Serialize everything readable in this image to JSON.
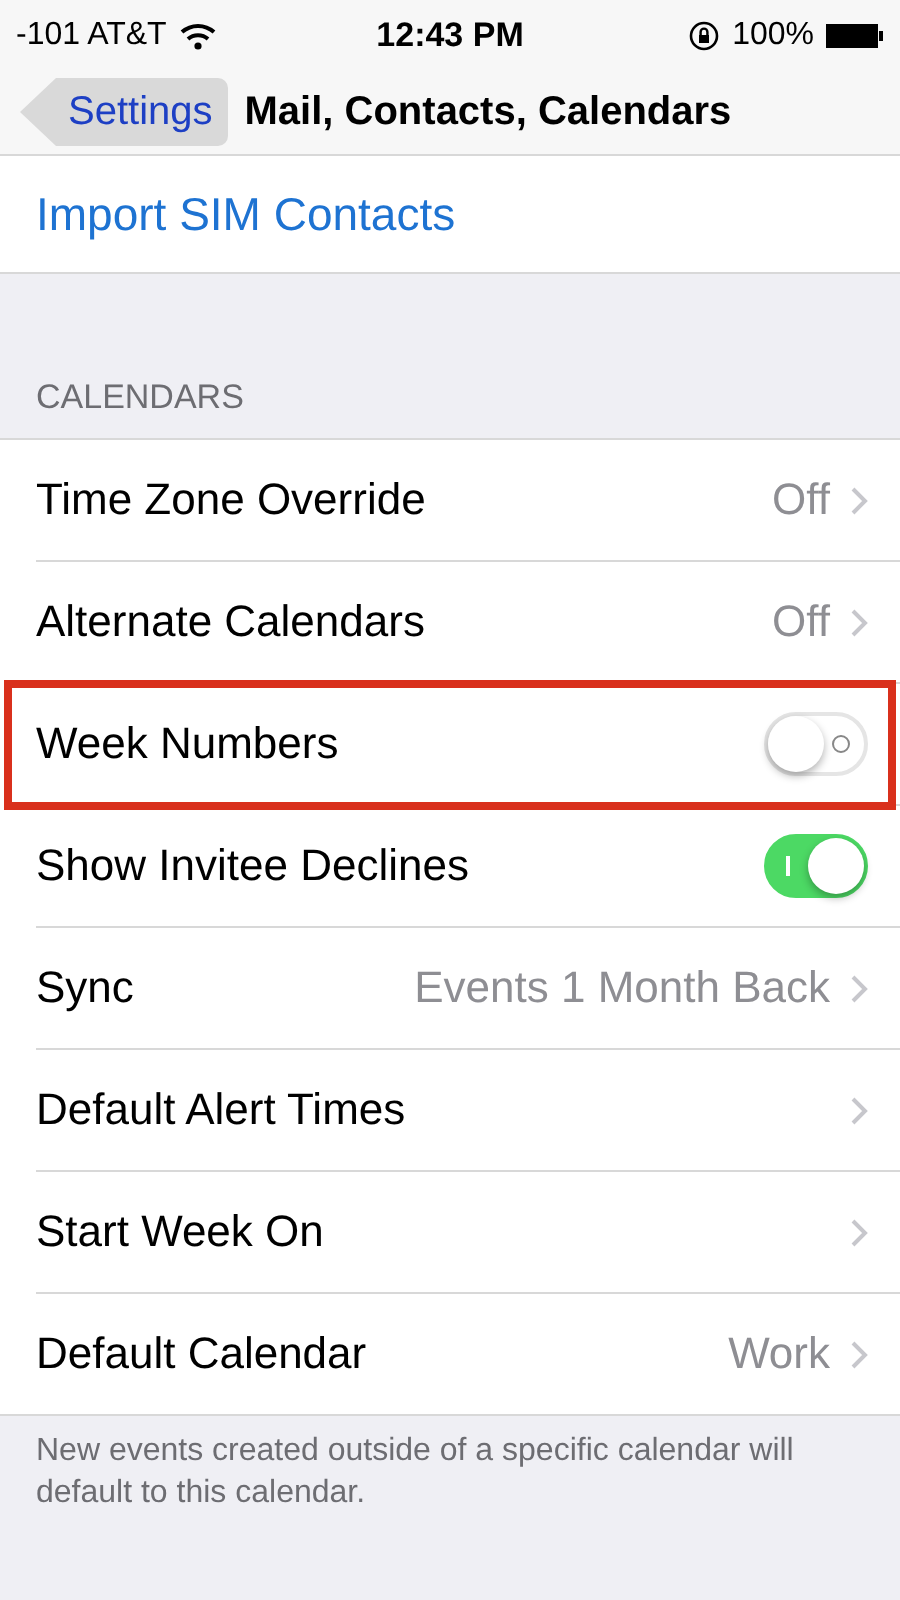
{
  "status_bar": {
    "carrier": "-101 AT&T",
    "time": "12:43 PM",
    "battery": "100%"
  },
  "nav_bar": {
    "back": "Settings",
    "title": "Mail, Contacts, Calendars"
  },
  "action": {
    "label": "Import SIM Contacts"
  },
  "section": {
    "header": "CALENDARS",
    "rows": [
      {
        "kind": "value",
        "label": "Time Zone Override",
        "value": "Off",
        "highlighted": false
      },
      {
        "kind": "value",
        "label": "Alternate Calendars",
        "value": "Off",
        "highlighted": false
      },
      {
        "kind": "toggle",
        "label": "Week Numbers",
        "on": false,
        "highlighted": true
      },
      {
        "kind": "toggle",
        "label": "Show Invitee Declines",
        "on": true,
        "highlighted": false
      },
      {
        "kind": "value",
        "label": "Sync",
        "value": "Events 1 Month Back",
        "highlighted": false
      },
      {
        "kind": "link",
        "label": "Default Alert Times",
        "highlighted": false
      },
      {
        "kind": "link",
        "label": "Start Week On",
        "highlighted": false
      },
      {
        "kind": "value",
        "label": "Default Calendar",
        "value": "Work",
        "highlighted": false
      }
    ],
    "footer": "New events created outside of a specific calendar will default to this calendar."
  }
}
